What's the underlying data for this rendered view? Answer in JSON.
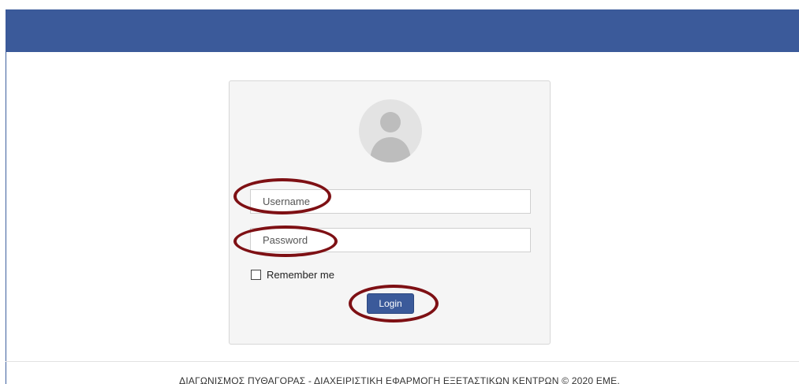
{
  "header": {
    "bar_color": "#3b5a9a"
  },
  "login": {
    "avatar_icon": "user-avatar-icon",
    "username_placeholder": "Username",
    "password_placeholder": "Password",
    "remember_label": "Remember me",
    "remember_checked": false,
    "login_label": "Login",
    "highlight_color": "#7e1014"
  },
  "footer": {
    "text": "ΔΙΑΓΩΝΙΣΜΟΣ ΠΥΘΑΓΟΡΑΣ - ΔΙΑΧΕΙΡΙΣΤΙΚΗ ΕΦΑΡΜΟΓΗ ΕΞΕΤΑΣΤΙΚΩΝ ΚΕΝΤΡΩΝ © 2020 ΕΜΕ."
  }
}
